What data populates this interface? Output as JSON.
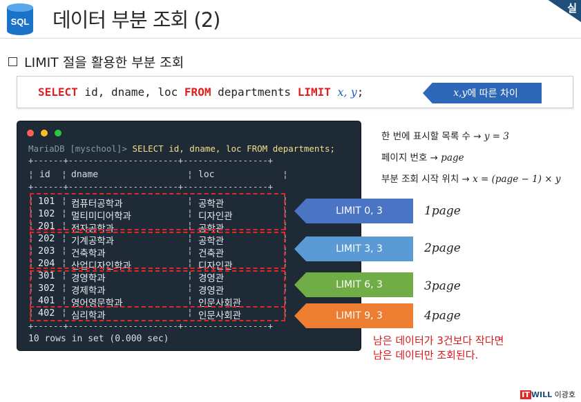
{
  "header": {
    "logo_text": "SQL",
    "title": "데이터 부분 조회 (2)",
    "corner_label": "실"
  },
  "section": {
    "heading": "LIMIT 절을 활용한 부분 조회"
  },
  "syntax": {
    "kw_select": "SELECT",
    "cols": " id, dname, loc ",
    "kw_from": "FROM",
    "table": " departments ",
    "kw_limit": "LIMIT",
    "var_x": "x",
    "comma": ", ",
    "var_y": "y",
    "semi": ";",
    "callout_vars": "x,y",
    "callout_text": "에 따른 차이"
  },
  "terminal": {
    "prompt": "MariaDB [myschool]> ",
    "command": "SELECT id, dname, loc FROM departments;",
    "border": "+------+----------------------+-----------------+",
    "col_id": "id",
    "col_dname": "dname",
    "col_loc": "loc",
    "rows": [
      {
        "id": "101",
        "dname": "컴퓨터공학과",
        "loc": "공학관"
      },
      {
        "id": "102",
        "dname": "멀티미디어학과",
        "loc": "디자인관"
      },
      {
        "id": "201",
        "dname": "전자공학과",
        "loc": "공학관"
      },
      {
        "id": "202",
        "dname": "기계공학과",
        "loc": "공학관"
      },
      {
        "id": "203",
        "dname": "건축학과",
        "loc": "건축관"
      },
      {
        "id": "204",
        "dname": "산업디자인학과",
        "loc": "디자인관"
      },
      {
        "id": "301",
        "dname": "경영학과",
        "loc": "경영관"
      },
      {
        "id": "302",
        "dname": "경제학과",
        "loc": "경영관"
      },
      {
        "id": "401",
        "dname": "영어영문학과",
        "loc": "인문사회관"
      },
      {
        "id": "402",
        "dname": "심리학과",
        "loc": "인문사회관"
      }
    ],
    "footer": "10 rows in set (0.000 sec)"
  },
  "info": {
    "line1_text": "한 번에 표시할 목록 수 → ",
    "line1_math": "y = 3",
    "line2_text": "페이지 번호 → ",
    "line2_math": "page",
    "line3_text": "부분 조회 시작 위치 → ",
    "line3_math": "x  =  (page − 1) × y"
  },
  "limits": [
    {
      "label": "LIMIT 0, 3",
      "page": "1page",
      "color": "#4a74c4"
    },
    {
      "label": "LIMIT 3, 3",
      "page": "2page",
      "color": "#5b9bd5"
    },
    {
      "label": "LIMIT 6, 3",
      "page": "3page",
      "color": "#70ad47"
    },
    {
      "label": "LIMIT 9, 3",
      "page": "4page",
      "color": "#ed7d31"
    }
  ],
  "note": {
    "line1": "남은 데이터가 3건보다 작다면",
    "line2": "남은 데이터만 조회된다."
  },
  "brand": {
    "it": "IT",
    "will": "WILL",
    "name": "이광호"
  },
  "colors": {
    "keyword": "#e01f1f",
    "terminal_bg": "#1e2a36",
    "accent": "#2f67b8",
    "note": "#d81818"
  }
}
